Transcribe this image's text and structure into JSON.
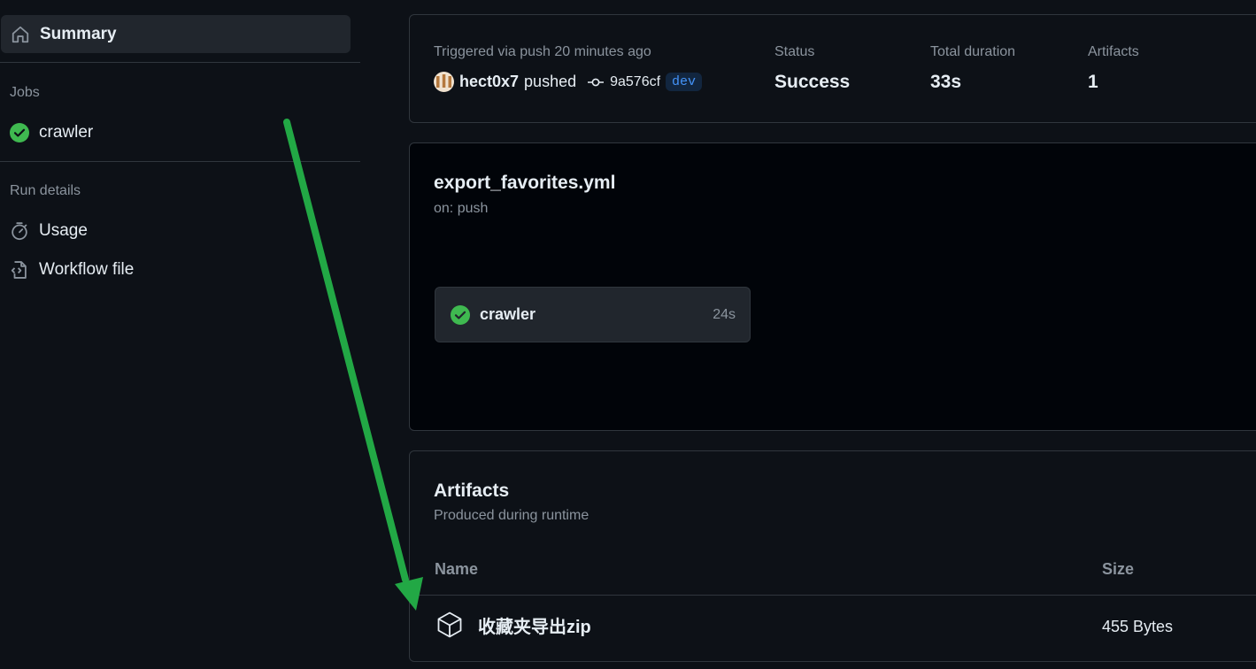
{
  "sidebar": {
    "summary_label": "Summary",
    "jobs_heading": "Jobs",
    "job_item_label": "crawler",
    "run_details_heading": "Run details",
    "usage_label": "Usage",
    "workflow_file_label": "Workflow file"
  },
  "run_info": {
    "trigger_text": "Triggered via push 20 minutes ago",
    "user": "hect0x7",
    "action": "pushed",
    "commit_sha": "9a576cf",
    "branch": "dev",
    "status_label": "Status",
    "status_value": "Success",
    "duration_label": "Total duration",
    "duration_value": "33s",
    "artifacts_label": "Artifacts",
    "artifacts_value": "1"
  },
  "workflow": {
    "file_name": "export_favorites.yml",
    "trigger": "on: push",
    "job_name": "crawler",
    "job_duration": "24s"
  },
  "artifacts": {
    "title": "Artifacts",
    "subtitle": "Produced during runtime",
    "col_name": "Name",
    "col_size": "Size",
    "items": [
      {
        "name": "收藏夹导出zip",
        "size": "455 Bytes"
      }
    ]
  },
  "colors": {
    "success": "#3fb950",
    "annotation_arrow": "#22a845",
    "link": "#4493f8"
  },
  "icons": [
    "home-icon",
    "check-circle-icon",
    "stopwatch-icon",
    "workflow-file-icon",
    "commit-icon",
    "package-icon",
    "arrow-annotation"
  ]
}
